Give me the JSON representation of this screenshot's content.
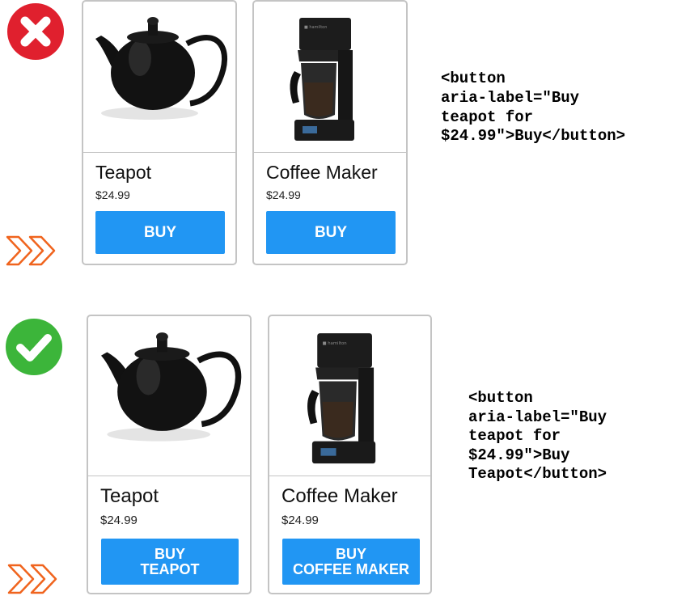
{
  "bad_example": {
    "status_icon": "x-icon",
    "status_color": "#e0202e",
    "products": [
      {
        "name": "Teapot",
        "price": "$24.99",
        "button_lines": [
          "BUY"
        ],
        "image": "teapot-image"
      },
      {
        "name": "Coffee Maker",
        "price": "$24.99",
        "button_lines": [
          "BUY"
        ],
        "image": "coffee-maker-image"
      }
    ],
    "code_lines": [
      "<button",
      "aria-label=\"Buy",
      "teapot for",
      "$24.99\">Buy</button>"
    ]
  },
  "good_example": {
    "status_icon": "check-icon",
    "status_color": "#3cb53a",
    "products": [
      {
        "name": "Teapot",
        "price": "$24.99",
        "button_lines": [
          "BUY",
          "TEAPOT"
        ],
        "image": "teapot-image"
      },
      {
        "name": "Coffee Maker",
        "price": "$24.99",
        "button_lines": [
          "BUY",
          "COFFEE MAKER"
        ],
        "image": "coffee-maker-image"
      }
    ],
    "code_lines": [
      "<button",
      "aria-label=\"Buy",
      "teapot for",
      "$24.99\">Buy",
      "Teapot</button>"
    ]
  },
  "colors": {
    "button": "#2196f3",
    "chevron": "#f0641e",
    "border": "#c4c4c4"
  },
  "decorations": {
    "chevron_icon": "double-chevron-right-icon"
  }
}
